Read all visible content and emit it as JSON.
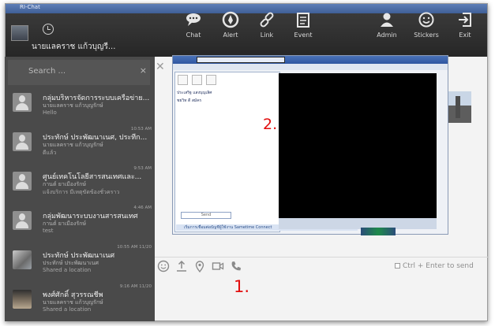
{
  "window": {
    "title": "RI-Chat"
  },
  "header": {
    "user_name": "นายแลคราช แก้วบุญรี..."
  },
  "nav": [
    {
      "key": "chat",
      "label": "Chat",
      "icon": "chat-icon"
    },
    {
      "key": "alert",
      "label": "Alert",
      "icon": "alert-icon"
    },
    {
      "key": "link",
      "label": "Link",
      "icon": "link-icon"
    },
    {
      "key": "event",
      "label": "Event",
      "icon": "event-icon"
    },
    {
      "key": "admin",
      "label": "Admin",
      "icon": "admin-icon"
    },
    {
      "key": "stickers",
      "label": "Stickers",
      "icon": "sticker-icon"
    },
    {
      "key": "exit",
      "label": "Exit",
      "icon": "exit-icon"
    }
  ],
  "sidebar": {
    "search_placeholder": "Search ...",
    "conversations": [
      {
        "name": "กลุ่มบริหารจัดการระบบเครือข่าย...",
        "sub": "นายแลคราช แก้วบุญรักษ์",
        "msg": "Hello",
        "time": ""
      },
      {
        "name": "ประทักษ์ ประพัฒนาเนศ, ประทีก...",
        "sub": "นายแลคราช แก้วบุญรักษ์",
        "msg": "ดีแล้ว",
        "time": "10:53 AM"
      },
      {
        "name": "ศูนย์เทคโนโลยีสารสนเทศและ...",
        "sub": "กานต์ ยาเมืองรักษ์",
        "msg": "แจ้งบริการ มีเหตุขัดข้องชั่วคราว",
        "time": "9:53 AM"
      },
      {
        "name": "กลุ่มพัฒนาระบบงานสารสนเทศ",
        "sub": "กานต์ ยาเมืองรักษ์",
        "msg": "test",
        "time": "4:46 AM"
      },
      {
        "name": "ประทักษ์ ประพัฒนาเนศ",
        "sub": "ประทักษ์ ประพัฒนาเนศ",
        "msg": "Shared a location",
        "time": "10:55 AM 11/20"
      },
      {
        "name": "พงศ์ศักดิ์ สุวรรณชีพ",
        "sub": "นายแลคราช แก้วบุญรักษ์",
        "msg": "Shared a location",
        "time": "9:16 AM 11/20"
      }
    ]
  },
  "screenshot_inner": {
    "list_rows": [
      "ประเสริฐ แสงบุญเลิศ",
      "ชยวิท ดี สมัคร"
    ],
    "send_button": "Send",
    "status_text": "เริ่มการเชื่อมต่อบัญชีผู้ใช้งาน Sametime Connect"
  },
  "annotations": {
    "marker_1": "1.",
    "marker_2": "2."
  },
  "compose": {
    "send_hint": "Ctrl + Enter to send"
  }
}
